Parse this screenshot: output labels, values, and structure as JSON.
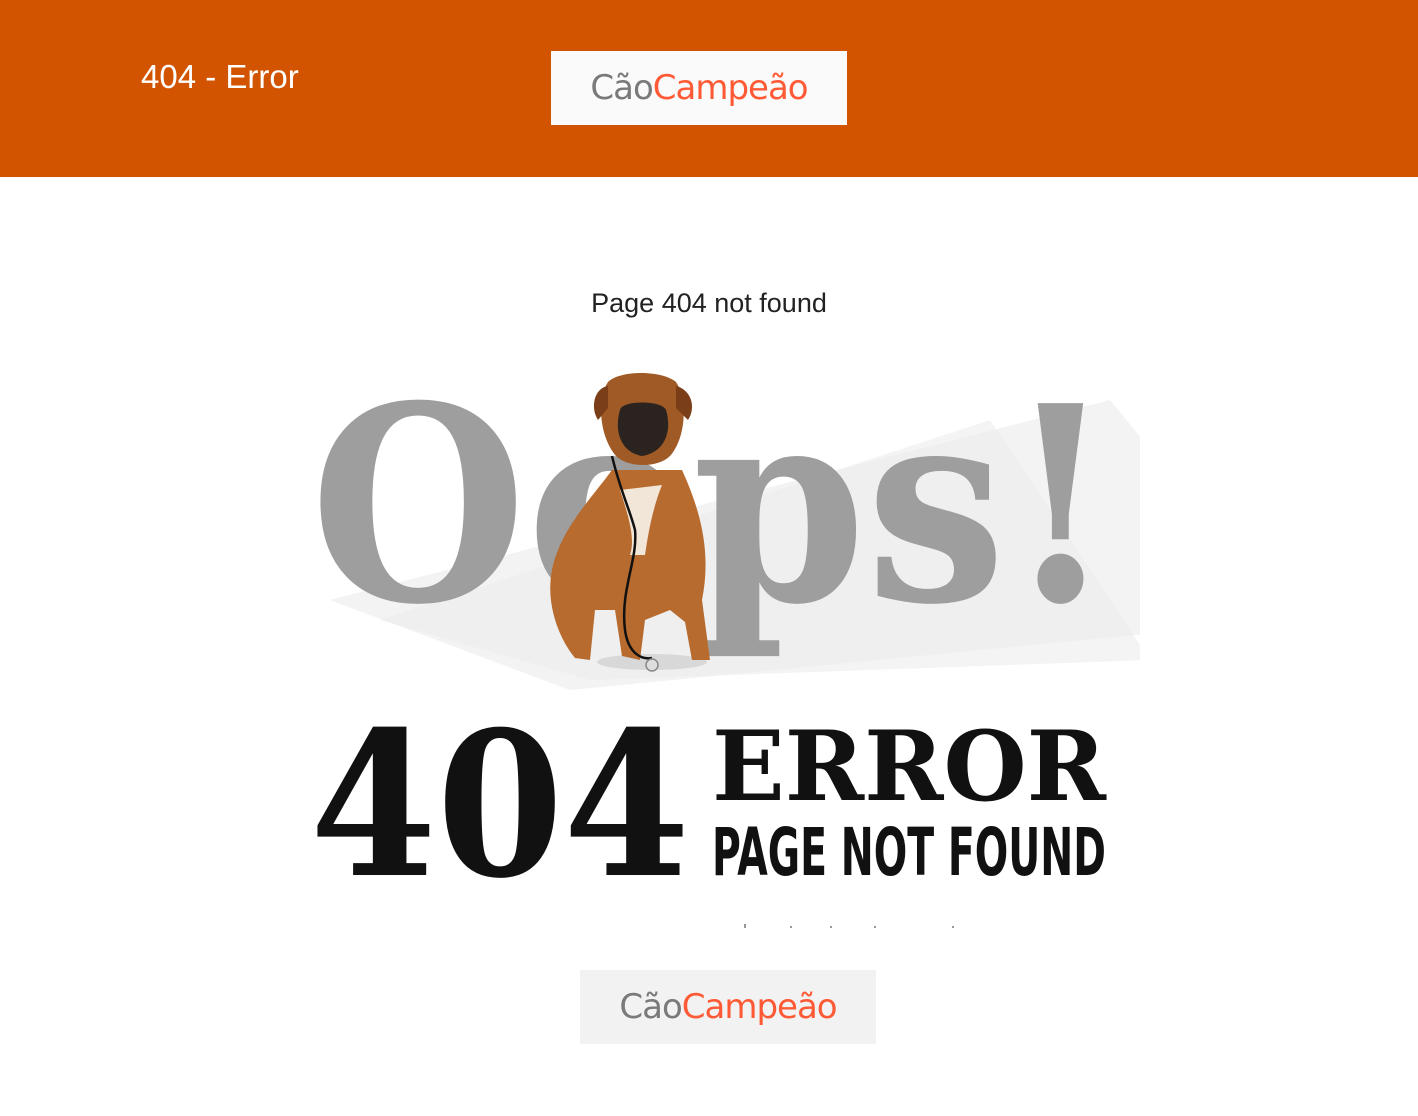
{
  "header": {
    "title": "404 - Error",
    "background": "#d35400",
    "logo": {
      "part1": "Cão",
      "part2": "Campeão"
    }
  },
  "main": {
    "message": "Page 404 not found",
    "illustration": {
      "headline": "Oops!",
      "code": "404",
      "error_word": "ERROR",
      "subtitle": "PAGE NOT FOUND"
    }
  },
  "footer": {
    "logo": {
      "part1": "Cão",
      "part2": "Campeão"
    }
  },
  "colors": {
    "accent": "#d35400",
    "logo_gray": "#7a7a7a",
    "logo_orange": "#ff5a36",
    "oops_gray": "#9e9e9e"
  }
}
